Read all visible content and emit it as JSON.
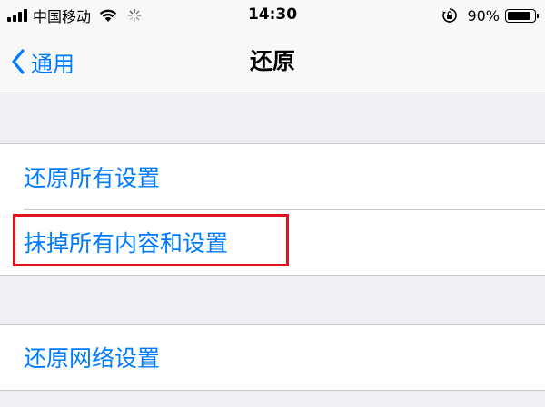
{
  "status_bar": {
    "carrier": "中国移动",
    "time": "14:30",
    "battery_percent": "90%",
    "battery_level": 0.9,
    "icons": [
      "signal-bars-icon",
      "wifi-icon",
      "activity-spinner-icon",
      "rotation-lock-icon",
      "battery-icon"
    ]
  },
  "nav": {
    "back_label": "通用",
    "title": "还原"
  },
  "group1": {
    "items": [
      {
        "label": "还原所有设置"
      },
      {
        "label": "抹掉所有内容和设置"
      }
    ]
  },
  "group2": {
    "items": [
      {
        "label": "还原网络设置"
      }
    ]
  },
  "colors": {
    "accent": "#007aff",
    "highlight": "#e0141e",
    "background": "#efeff4"
  }
}
